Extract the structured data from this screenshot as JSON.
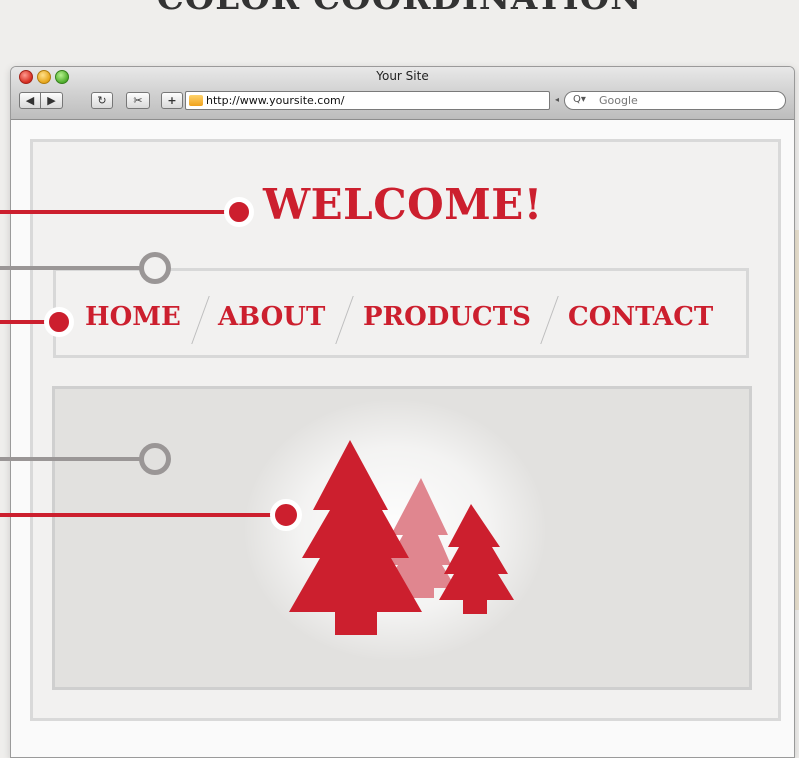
{
  "page": {
    "heading": "COLOR COORDINATION"
  },
  "browser": {
    "title": "Your Site",
    "url": "http://www.yoursite.com/",
    "search_placeholder": "Google",
    "search_icon_glyph": "Q▾",
    "back_glyph": "◀",
    "forward_glyph": "▶",
    "reload_glyph": "↻",
    "snap_glyph": "✂",
    "add_glyph": "+"
  },
  "site": {
    "welcome": "WELCOME!",
    "nav": [
      "HOME",
      "ABOUT",
      "PRODUCTS",
      "CONTACT"
    ]
  },
  "colors": {
    "accent_red": "#cc1f2e",
    "accent_pink": "#e0868f",
    "callout_gray": "#9a9696",
    "background": "#efeeec"
  },
  "icons": [
    "close-icon",
    "minimize-icon",
    "zoom-icon",
    "back-icon",
    "forward-icon",
    "reload-icon",
    "snapback-icon",
    "add-bookmark-icon",
    "folder-icon",
    "search-icon",
    "tree-icon"
  ]
}
